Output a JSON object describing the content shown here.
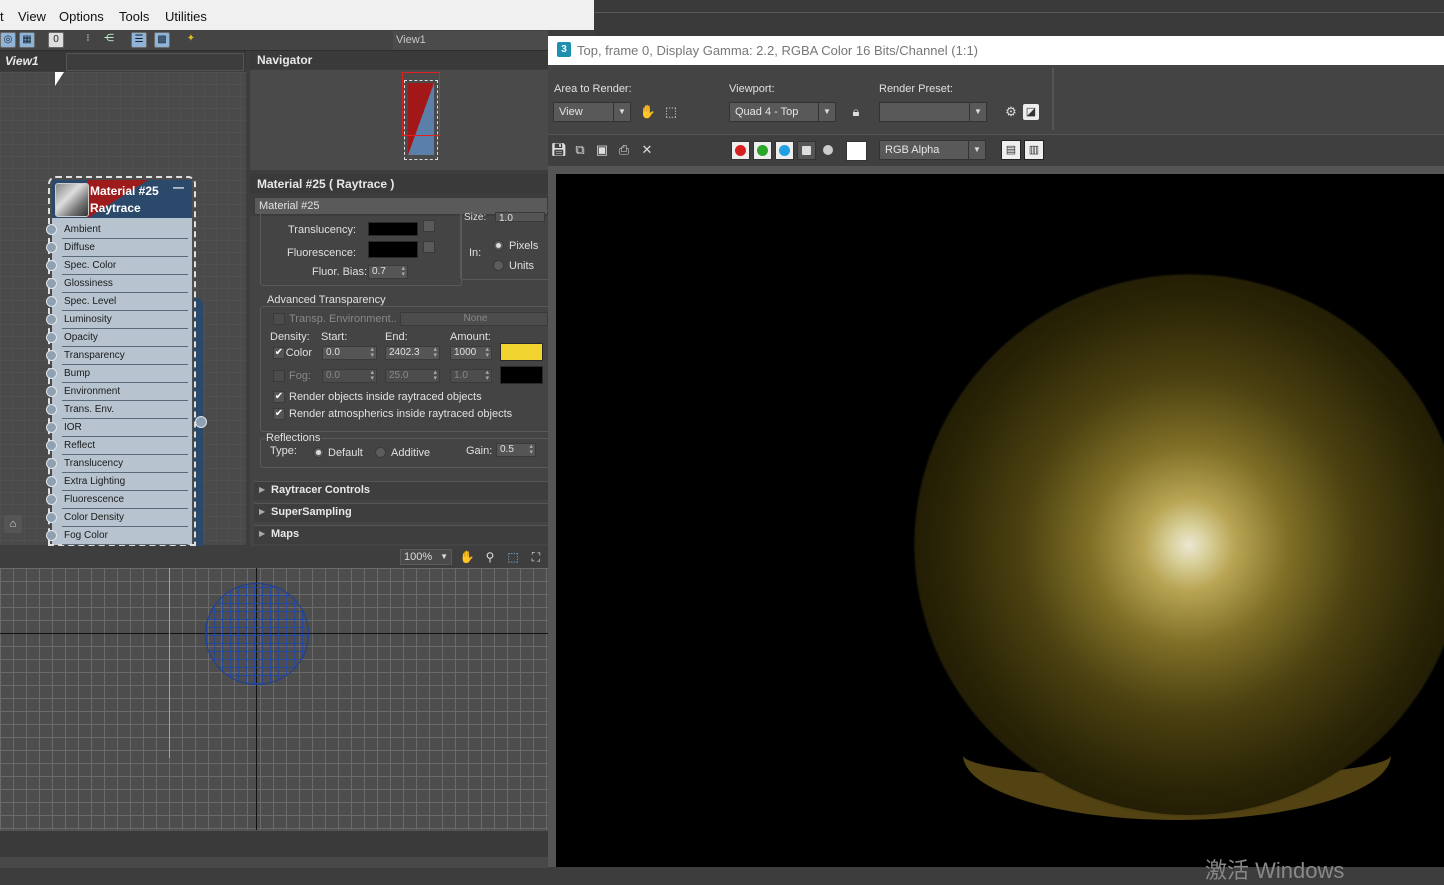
{
  "menubar": {
    "items": [
      "t",
      "View",
      "Options",
      "Tools",
      "Utilities"
    ]
  },
  "toolbar": {
    "view_tab": "View1"
  },
  "view": {
    "title": "View1"
  },
  "navigator": {
    "title": "Navigator"
  },
  "node": {
    "name": "Material #25",
    "type": "Raytrace",
    "minimize": "—",
    "slots": [
      "Ambient",
      "Diffuse",
      "Spec. Color",
      "Glossiness",
      "Spec. Level",
      "Luminosity",
      "Opacity",
      "Transparency",
      "Bump",
      "Environment",
      "Trans. Env.",
      "IOR",
      "Reflect",
      "Translucency",
      "Extra Lighting",
      "Fluorescence",
      "Color Density",
      "Fog Color"
    ]
  },
  "material_panel": {
    "title": "Material #25  ( Raytrace )",
    "name_field": "Material #25",
    "size_label": "Size:",
    "size_value": "1.0",
    "translucency_label": "Translucency:",
    "fluorescence_label": "Fluorescence:",
    "fluor_bias_label": "Fluor. Bias:",
    "fluor_bias_value": "0.7",
    "in_label": "In:",
    "pixels_label": "Pixels",
    "units_label": "Units",
    "adv_transparency_title": "Advanced Transparency",
    "transp_env_label": "Transp. Environment..",
    "transp_env_value": "None",
    "density_label": "Density:",
    "start_label": "Start:",
    "end_label": "End:",
    "amount_label": "Amount:",
    "color_label": "Color:",
    "color_start": "0.0",
    "color_end": "2402.3",
    "color_amount": "1000",
    "color_swatch": "#f2d430",
    "fog_label": "Fog:",
    "fog_start": "0.0",
    "fog_end": "25.0",
    "fog_amount": "1.0",
    "fog_swatch": "#000000",
    "render_objects_label": "Render objects inside raytraced objects",
    "render_atmos_label": "Render atmospherics inside raytraced objects",
    "reflections_title": "Reflections",
    "type_label": "Type:",
    "default_label": "Default",
    "additive_label": "Additive",
    "gain_label": "Gain:",
    "gain_value": "0.5",
    "rollouts": [
      "Raytracer Controls",
      "SuperSampling",
      "Maps"
    ]
  },
  "viewport": {
    "zoom": "100%"
  },
  "render_frame": {
    "title": "Top, frame 0, Display Gamma: 2.2, RGBA Color 16 Bits/Channel (1:1)",
    "app_icon": "3",
    "area_to_render_label": "Area to Render:",
    "area_to_render_value": "View",
    "viewport_label": "Viewport:",
    "viewport_value": "Quad 4 - Top",
    "render_preset_label": "Render Preset:",
    "render_preset_value": "",
    "channel_value": "RGB Alpha",
    "watermark": "激活 Windows"
  },
  "colors": {
    "red_channel": "#d42020",
    "green_channel": "#2aa52a",
    "blue_channel": "#1fa0e0",
    "node_header": "#2b4a6b",
    "node_body": "#b7c4cf"
  }
}
